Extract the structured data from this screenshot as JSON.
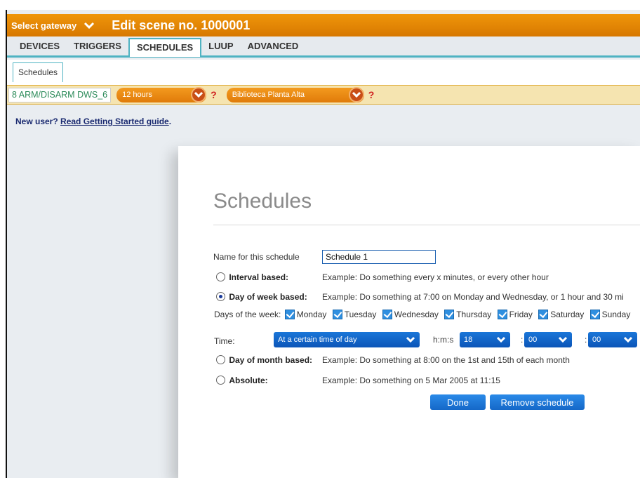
{
  "topbar": {
    "gateway_label": "Select gateway",
    "title": "Edit scene no. 1000001"
  },
  "tabs": [
    {
      "label": "DEVICES"
    },
    {
      "label": "TRIGGERS"
    },
    {
      "label": "SCHEDULES"
    },
    {
      "label": "LUUP"
    },
    {
      "label": "ADVANCED"
    }
  ],
  "subtab": {
    "label": "Schedules"
  },
  "filterbar": {
    "device": "8 ARM/DISARM DWS_6",
    "interval": "12 hours",
    "room": "Biblioteca Planta Alta",
    "help": "?"
  },
  "newuser": {
    "prefix": "New user?",
    "link": "Read Getting Started guide",
    "suffix": "."
  },
  "dialog": {
    "title": "Schedules",
    "name_label": "Name for this schedule",
    "name_value": "Schedule 1",
    "interval": {
      "label": "Interval based:",
      "example": "Example: Do something every x minutes, or every other hour"
    },
    "dow": {
      "label": "Day of week based:",
      "example": "Example: Do something at 7:00 on Monday and Wednesday, or 1 hour and 30 mi"
    },
    "days_label": "Days of the week:",
    "days": [
      "Monday",
      "Tuesday",
      "Wednesday",
      "Thursday",
      "Friday",
      "Saturday",
      "Sunday"
    ],
    "time_label": "Time:",
    "time_mode": "At a certain time of day",
    "hms_label": "h:m:s",
    "hour": "18",
    "minute": "00",
    "second": "00",
    "colon": ":",
    "dom": {
      "label": "Day of month based:",
      "example": "Example: Do something at 8:00 on the 1st and 15th of each month"
    },
    "absolute": {
      "label": "Absolute:",
      "example": "Example: Do something on 5 Mar 2005 at 11:15"
    },
    "done": "Done",
    "remove": "Remove schedule"
  },
  "colors": {
    "orange": "#e28400",
    "teal": "#4fb3c2",
    "blue": "#1568c8"
  }
}
